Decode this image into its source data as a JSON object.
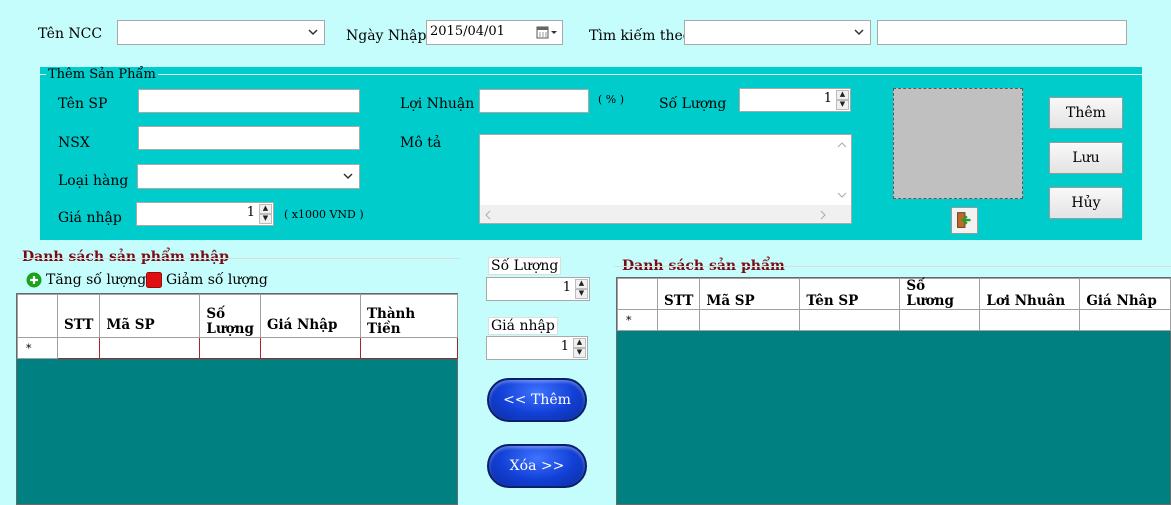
{
  "header": {
    "supplier_label": "Tên NCC",
    "supplier_value": "",
    "date_label": "Ngày Nhập",
    "date_value": "2015/04/01",
    "search_label": "Tìm kiếm theo",
    "search_select_value": "",
    "search_text_value": ""
  },
  "add_product": {
    "legend": "Thêm Sản Phẩm",
    "name_label": "Tên SP",
    "name_value": "",
    "maker_label": "NSX",
    "maker_value": "",
    "category_label": "Loại hàng",
    "category_value": "",
    "price_label": "Giá nhập",
    "price_value": "1",
    "price_unit": "( x1000 VND )",
    "profit_label": "Lợi Nhuận",
    "profit_value": "",
    "profit_unit": "( % )",
    "desc_label": "Mô tả",
    "desc_value": "",
    "qty_label": "Số Lượng",
    "qty_value": "1",
    "add_button": "Thêm",
    "save_button": "Lưu",
    "cancel_button": "Hủy"
  },
  "import_list": {
    "title": "Danh sách sản phẩm nhập",
    "increase_label": "Tăng số lượng",
    "decrease_label": "Giảm số lượng",
    "columns": [
      "STT",
      "Mã SP",
      "Số\nLượng",
      "Giá Nhập",
      "Thành\nTiền"
    ],
    "new_row_marker": "*"
  },
  "middle": {
    "qty_label": "Số Lượng",
    "qty_value": "1",
    "price_label": "Giá nhập",
    "price_value": "1",
    "add_button": "<< Thêm",
    "remove_button": "Xóa >>"
  },
  "product_list": {
    "title": "Danh sách sản phẩm",
    "columns": [
      "STT",
      "Mã SP",
      "Tên SP",
      "Số Lương",
      "Lơi Nhuân",
      "Giá Nhâp"
    ],
    "new_row_marker": "*"
  },
  "colors": {
    "background": "#c5fdfc",
    "panel": "#00cccc",
    "grid_background": "#008080",
    "section_title": "#7a0b12",
    "action_button": "#1240d6"
  }
}
